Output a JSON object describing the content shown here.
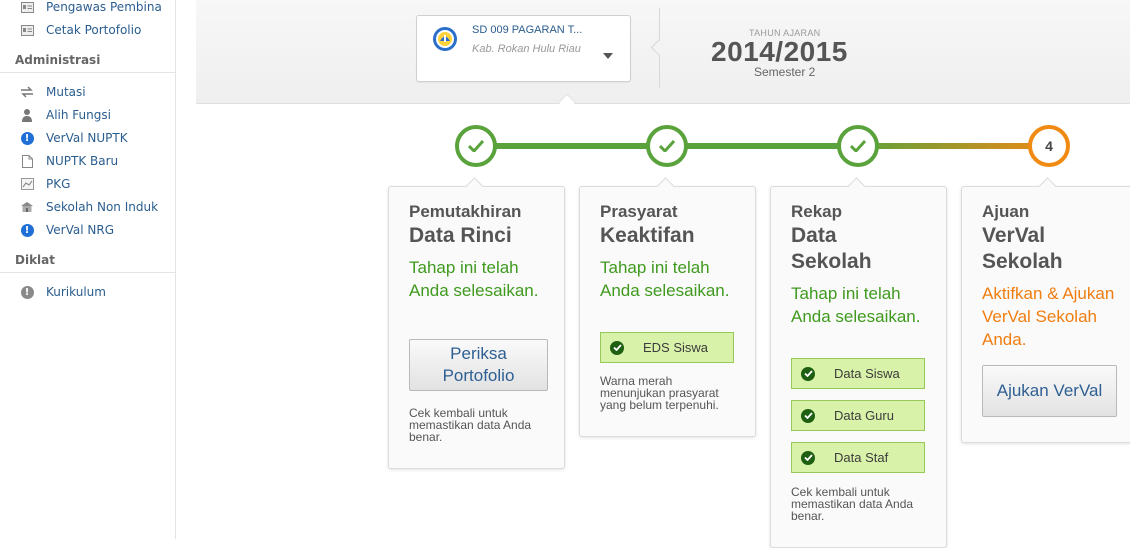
{
  "sidebar": {
    "top_items": [
      {
        "label": "Pengawas Pembina",
        "icon": "id-card-icon"
      },
      {
        "label": "Cetak Portofolio",
        "icon": "id-card-icon"
      }
    ],
    "sections": [
      {
        "title": "Administrasi",
        "items": [
          {
            "label": "Mutasi",
            "icon": "transfer-icon"
          },
          {
            "label": "Alih Fungsi",
            "icon": "person-icon"
          },
          {
            "label": "VerVal NUPTK",
            "icon": "info-icon"
          },
          {
            "label": "NUPTK Baru",
            "icon": "document-icon"
          },
          {
            "label": "PKG",
            "icon": "chart-icon"
          },
          {
            "label": "Sekolah Non Induk",
            "icon": "school-icon"
          },
          {
            "label": "VerVal NRG",
            "icon": "info-icon"
          }
        ]
      },
      {
        "title": "Diklat",
        "items": [
          {
            "label": "Kurikulum",
            "icon": "info-grey-icon"
          }
        ]
      }
    ]
  },
  "header": {
    "school_select": {
      "name": "SD 009 PAGARAN T...",
      "region": "Kab. Rokan Hulu Riau"
    },
    "tahun_ajaran_label": "TAHUN AJARAN",
    "tahun_ajaran": "2014/2015",
    "semester": "Semester 2"
  },
  "steps": [
    {
      "state": "done",
      "icon": "check-icon"
    },
    {
      "state": "done",
      "icon": "check-icon"
    },
    {
      "state": "done",
      "icon": "check-icon"
    },
    {
      "state": "current",
      "number": "4"
    }
  ],
  "colors": {
    "done": "#5aa33c",
    "current": "#f08a12",
    "link": "#2a5d8f"
  },
  "cards": [
    {
      "title_line1": "Pemutakhiran",
      "title_line2": "Data Rinci",
      "status": "Tahap ini telah Anda selesaikan.",
      "button": "Periksa Portofolio",
      "note": "Cek kembali untuk memastikan data Anda benar."
    },
    {
      "title_line1": "Prasyarat",
      "title_line2": "Keaktifan",
      "status": "Tahap ini telah Anda selesaikan.",
      "checks": [
        "EDS Siswa"
      ],
      "note": "Warna merah menunjukan prasyarat yang belum terpenuhi."
    },
    {
      "title_line1": "Rekap",
      "title_line2": "Data",
      "title_line3": "Sekolah",
      "status": "Tahap ini telah Anda selesaikan.",
      "checks": [
        "Data Siswa",
        "Data Guru",
        "Data Staf"
      ],
      "note": "Cek kembali untuk memastikan data Anda benar."
    },
    {
      "title_line1": "Ajuan",
      "title_line2": "VerVal",
      "title_line3": "Sekolah",
      "status": "Aktifkan & Ajukan VerVal Sekolah Anda.",
      "button": "Ajukan VerVal"
    }
  ]
}
